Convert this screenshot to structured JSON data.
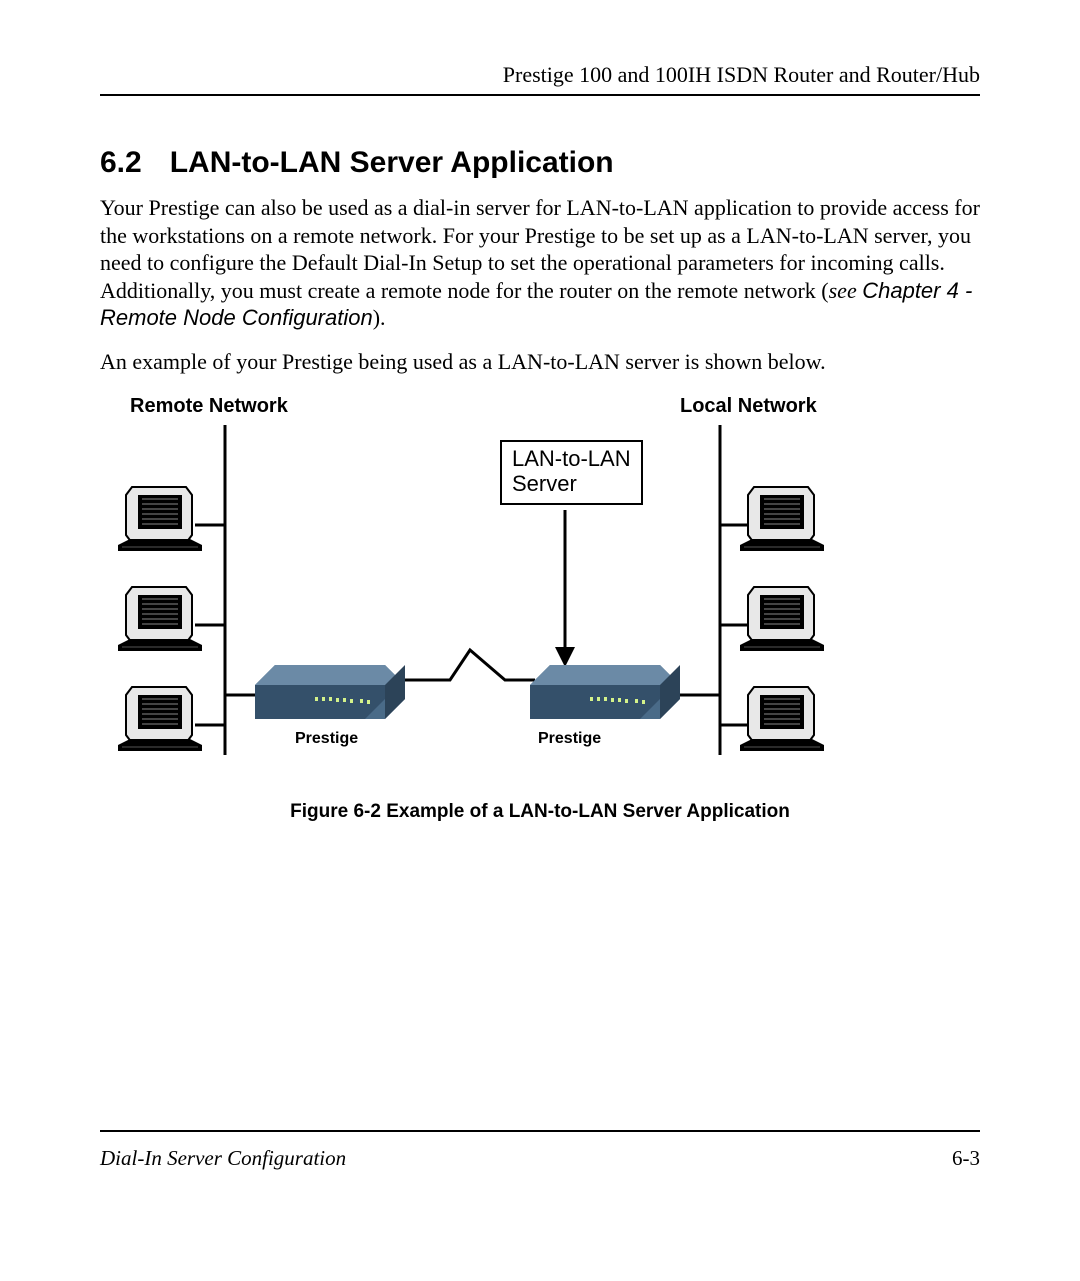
{
  "runningHead": "Prestige 100 and 100IH ISDN Router and Router/Hub",
  "section": {
    "number": "6.2",
    "title": "LAN-to-LAN Server Application"
  },
  "para1_a": "Your Prestige can also be used as a dial-in server for LAN-to-LAN application to provide access for the workstations on a remote network.  For your Prestige to be set up as a LAN-to-LAN server, you need to configure the Default Dial-In Setup to set the operational parameters for incoming calls.  Additionally, you must create a remote node for the router on the remote network (",
  "para1_see": "see ",
  "para1_ref": "Chapter 4 - Remote Node Configuration",
  "para1_b": ").",
  "para2": "An example of your Prestige being used as a LAN-to-LAN server is shown below.",
  "figure": {
    "leftTitle": "Remote Network",
    "rightTitle": "Local Network",
    "box_line1": "LAN-to-LAN",
    "box_line2": "Server",
    "deviceLabel": "Prestige",
    "caption": "Figure 6-2 Example of a LAN-to-LAN Server Application"
  },
  "footer": {
    "sectionName": "Dial-In Server Configuration",
    "pageNum": "6-3"
  }
}
